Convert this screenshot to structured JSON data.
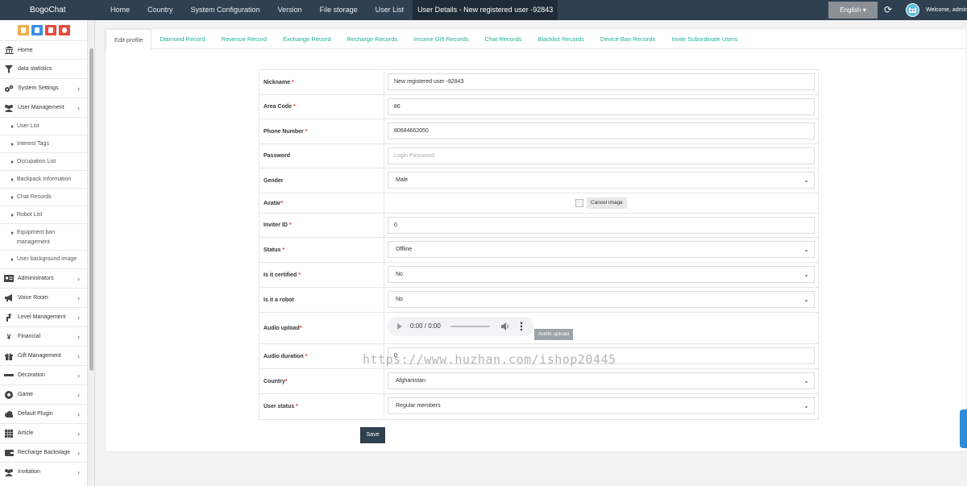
{
  "topbar": {
    "brand": "BogoChat",
    "nav": [
      "Home",
      "Country",
      "System Configuration",
      "Version",
      "File storage",
      "User List",
      "User Details - New registered user -92843"
    ],
    "language": "English ▾",
    "welcome": "Welcome, admin"
  },
  "sidebar": {
    "quick_buttons": [
      {
        "name": "home-quick-icon",
        "color": "#f0ad4e"
      },
      {
        "name": "file-quick-icon",
        "color": "#3a8ee6"
      },
      {
        "name": "trash-quick-icon",
        "color": "#e64c3c"
      },
      {
        "name": "refresh-quick-icon",
        "color": "#e64c3c"
      }
    ],
    "items": [
      {
        "label": "Home",
        "icon": "bank-icon"
      },
      {
        "label": "data statistics",
        "icon": "funnel-icon"
      },
      {
        "label": "System Settings",
        "icon": "gears-icon"
      },
      {
        "label": "User Management",
        "icon": "users-icon"
      },
      {
        "label": "Administrators",
        "icon": "id-card-icon"
      },
      {
        "label": "Voice Room",
        "icon": "megaphone-icon"
      },
      {
        "label": "Level Management",
        "icon": "level-up-icon"
      },
      {
        "label": "Financial",
        "icon": "yen-icon"
      },
      {
        "label": "Gift Management",
        "icon": "gift-icon"
      },
      {
        "label": "Decoration",
        "icon": "minus-icon"
      },
      {
        "label": "Game",
        "icon": "soccer-icon"
      },
      {
        "label": "Default Plugin",
        "icon": "cloud-icon"
      },
      {
        "label": "Article",
        "icon": "grid-icon"
      },
      {
        "label": "Recharge Backstage",
        "icon": "wallet-icon"
      },
      {
        "label": "Invitation",
        "icon": "users-icon"
      }
    ],
    "sub_items": [
      "User List",
      "Interest Tags",
      "Occupation List",
      "Backpack Information",
      "Chat Records",
      "Robot List",
      "Equipment ban management",
      "User background image"
    ]
  },
  "tabs": [
    "Edit profile",
    "Diamond Record",
    "Revenue Record",
    "Exchange Record",
    "Recharge Records",
    "Income Gift Records",
    "Chat Records",
    "Blacklist Records",
    "Device Ban Records",
    "Invite Subordinate Users"
  ],
  "form": {
    "nickname": {
      "label": "Nickname",
      "value": "New registered user -92843"
    },
    "area_code": {
      "label": "Area Code",
      "value": "86"
    },
    "phone": {
      "label": "Phone Number",
      "value": "80684662050"
    },
    "password": {
      "label": "Password",
      "placeholder": "Login Password"
    },
    "gender": {
      "label": "Gender",
      "value": "Male"
    },
    "avatar": {
      "label": "Avatar",
      "cancel_label": "Cancel image"
    },
    "inviter_id": {
      "label": "Inviter ID",
      "value": "0"
    },
    "status": {
      "label": "Status",
      "value": "Offline"
    },
    "certified": {
      "label": "Is it certified",
      "value": "No"
    },
    "robot": {
      "label": "Is it a robot",
      "value": "No"
    },
    "audio_upload": {
      "label": "Audio upload",
      "time": "0:00 / 0:00",
      "button": "Audio upload"
    },
    "audio_duration": {
      "label": "Audio duration",
      "value": "0"
    },
    "country": {
      "label": "Country",
      "value": "Afghanistan"
    },
    "user_status": {
      "label": "User status",
      "value": "Regular members"
    }
  },
  "save_label": "Save",
  "watermark": "https://www.huzhan.com/ishop20445",
  "colors": {
    "topbar": "#2f4050",
    "accent": "#1ab394",
    "required": "#e33333"
  }
}
